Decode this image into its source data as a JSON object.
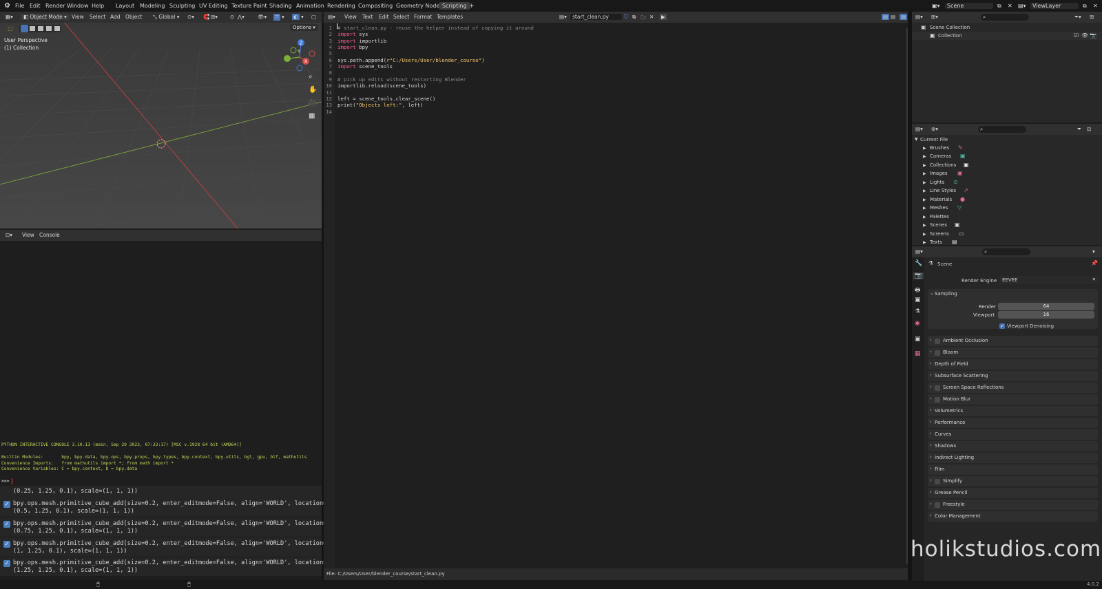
{
  "menu": {
    "items": [
      "File",
      "Edit",
      "Render",
      "Window",
      "Help"
    ]
  },
  "workspaces": [
    "Layout",
    "Modeling",
    "Sculpting",
    "UV Editing",
    "Texture Paint",
    "Shading",
    "Animation",
    "Rendering",
    "Compositing",
    "Geometry Nodes",
    "Scripting"
  ],
  "active_workspace": "Scripting",
  "top_right": {
    "scene": "Scene",
    "view_layer": "ViewLayer"
  },
  "viewport": {
    "mode": "Object Mode",
    "menus": [
      "View",
      "Select",
      "Add",
      "Object"
    ],
    "orientation": "Global",
    "options": "Options",
    "overlay_title": "User Perspective",
    "overlay_sub": "(1) Collection",
    "gizmo": {
      "x": "X",
      "y": "Y",
      "z": "Z"
    }
  },
  "console": {
    "menus": [
      "View",
      "Console"
    ],
    "lines": [
      "PYTHON INTERACTIVE CONSOLE 3.10.13 (main, Sep 20 2023, 07:33:17) [MSC v.1928 64 bit (AMD64)]",
      "",
      "Builtin Modules:       bpy, bpy.data, bpy.ops, bpy.props, bpy.types, bpy.context, bpy.utils, bgl, gpu, blf, mathutils",
      "Convenience Imports:   from mathutils import *; from math import *",
      "Convenience Variables: C = bpy.context, D = bpy.data",
      "",
      ">>> "
    ]
  },
  "info": {
    "partial": "(0.25, 1.25, 0.1), scale=(1, 1, 1))",
    "rows": [
      {
        "l1": "bpy.ops.mesh.primitive_cube_add(size=0.2, enter_editmode=False, align='WORLD', location=",
        "l2": "(0.5, 1.25, 0.1), scale=(1, 1, 1))"
      },
      {
        "l1": "bpy.ops.mesh.primitive_cube_add(size=0.2, enter_editmode=False, align='WORLD', location=",
        "l2": "(0.75, 1.25, 0.1), scale=(1, 1, 1))"
      },
      {
        "l1": "bpy.ops.mesh.primitive_cube_add(size=0.2, enter_editmode=False, align='WORLD', location=",
        "l2": "(1, 1.25, 0.1), scale=(1, 1, 1))"
      },
      {
        "l1": "bpy.ops.mesh.primitive_cube_add(size=0.2, enter_editmode=False, align='WORLD', location=",
        "l2": "(1.25, 1.25, 0.1), scale=(1, 1, 1))"
      }
    ]
  },
  "text_editor": {
    "menus": [
      "View",
      "Text",
      "Edit",
      "Select",
      "Format",
      "Templates"
    ],
    "filename": "start_clean.py",
    "status": "File: C:/Users/User/blender_course/start_clean.py",
    "line_numbers": [
      "1",
      "2",
      "3",
      "4",
      "5",
      "6",
      "7",
      "8",
      "9",
      "10",
      "11",
      "12",
      "13",
      "14"
    ],
    "lines": [
      [
        {
          "t": "# start_clean.py - reuse the helper instead of copying it around",
          "c": "cm"
        }
      ],
      [
        {
          "t": "import",
          "c": "kw"
        },
        {
          "t": " sys",
          "c": ""
        }
      ],
      [
        {
          "t": "import",
          "c": "kw"
        },
        {
          "t": " importlib",
          "c": ""
        }
      ],
      [
        {
          "t": "import",
          "c": "kw"
        },
        {
          "t": " bpy",
          "c": ""
        }
      ],
      [],
      [
        {
          "t": "sys.path.append(",
          "c": ""
        },
        {
          "t": "r\"C:/Users/User/blender_course\"",
          "c": "str"
        },
        {
          "t": ")",
          "c": ""
        }
      ],
      [
        {
          "t": "import",
          "c": "kw"
        },
        {
          "t": " scene_tools",
          "c": ""
        }
      ],
      [],
      [
        {
          "t": "# pick up edits without restarting Blender",
          "c": "cm"
        }
      ],
      [
        {
          "t": "importlib.reload(scene_tools)",
          "c": ""
        }
      ],
      [],
      [
        {
          "t": "left = scene_tools.clear_scene()",
          "c": ""
        }
      ],
      [
        {
          "t": "print(",
          "c": ""
        },
        {
          "t": "\"Objects left:\"",
          "c": "str"
        },
        {
          "t": ", left)",
          "c": ""
        }
      ],
      []
    ]
  },
  "outliner": {
    "scene_collection": "Scene Collection",
    "collection": "Collection"
  },
  "file_browser": {
    "root": "Current File",
    "items": [
      "Brushes",
      "Cameras",
      "Collections",
      "Images",
      "Lights",
      "Line Styles",
      "Materials",
      "Meshes",
      "Palettes",
      "Scenes",
      "Screens",
      "Texts"
    ]
  },
  "properties": {
    "context": "Scene",
    "render_engine_label": "Render Engine",
    "render_engine": "EEVEE",
    "sampling": {
      "title": "Sampling",
      "render_label": "Render",
      "render": "64",
      "viewport_label": "Viewport",
      "viewport": "16",
      "denoise": "Viewport Denoising"
    },
    "panels": [
      {
        "label": "Ambient Occlusion",
        "cb": true
      },
      {
        "label": "Bloom",
        "cb": true
      },
      {
        "label": "Depth of Field",
        "cb": false
      },
      {
        "label": "Subsurface Scattering",
        "cb": false
      },
      {
        "label": "Screen Space Reflections",
        "cb": true
      },
      {
        "label": "Motion Blur",
        "cb": true
      },
      {
        "label": "Volumetrics",
        "cb": false
      },
      {
        "label": "Performance",
        "cb": false
      },
      {
        "label": "Curves",
        "cb": false
      },
      {
        "label": "Shadows",
        "cb": false
      },
      {
        "label": "Indirect Lighting",
        "cb": false
      },
      {
        "label": "Film",
        "cb": false
      },
      {
        "label": "Simplify",
        "cb": true
      },
      {
        "label": "Grease Pencil",
        "cb": false
      },
      {
        "label": "Freestyle",
        "cb": true
      },
      {
        "label": "Color Management",
        "cb": false
      }
    ]
  },
  "version": "4.0.2",
  "watermark": "holikstudios.com",
  "colors": {
    "accent": "#4772b3",
    "x_axis": "#d84a4a",
    "y_axis": "#7bb03a",
    "z_axis": "#3f7ad8"
  }
}
